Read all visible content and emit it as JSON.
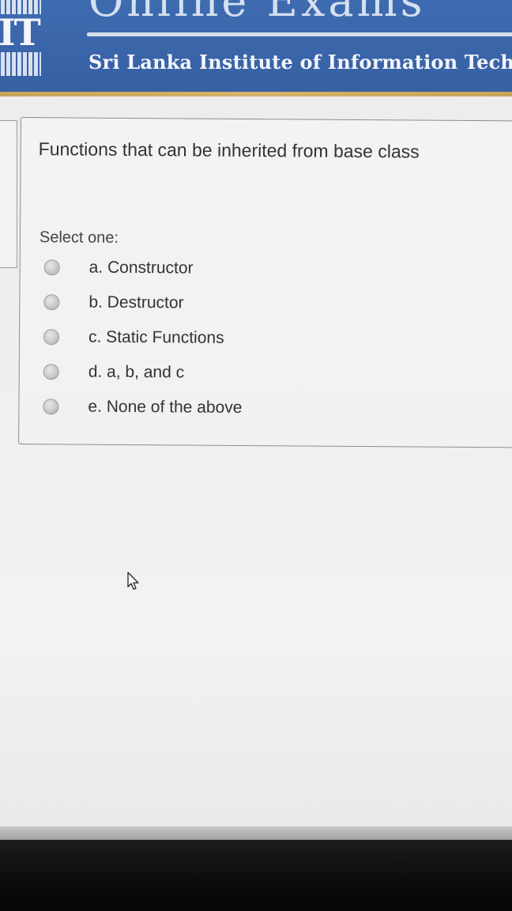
{
  "header": {
    "logo_text": "IT",
    "title": "Online Exams",
    "institute": "Sri Lanka Institute of Information Tech"
  },
  "question": {
    "text": "Functions that can be inherited from base class",
    "prompt": "Select one:",
    "options": [
      {
        "label": "a. Constructor",
        "selected": false
      },
      {
        "label": "b. Destructor",
        "selected": false
      },
      {
        "label": "c. Static Functions",
        "selected": false
      },
      {
        "label": "d. a, b, and c",
        "selected": false
      },
      {
        "label": "e. None of the above",
        "selected": false
      }
    ]
  },
  "icons": {
    "cursor": "mouse-pointer-icon"
  },
  "colors": {
    "header_blue": "#3e6bb0",
    "header_stripe": "#c9a35a"
  }
}
